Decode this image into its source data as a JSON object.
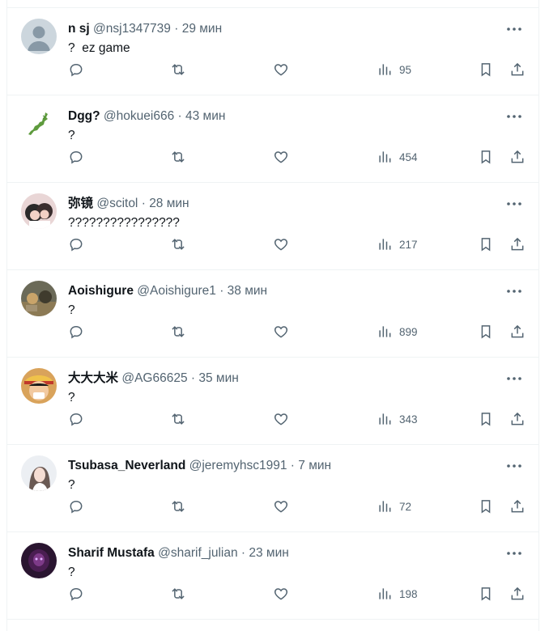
{
  "tweets": [
    {
      "name": "n sj",
      "handle": "@nsj1347739",
      "time": "29 мин",
      "text": "?  ez game",
      "views": "95",
      "avatar_color": "#ccd6dd"
    },
    {
      "name": "Dgg?",
      "handle": "@hokuei666",
      "time": "43 мин",
      "text": "?",
      "views": "454",
      "avatar_color": "#ffffff"
    },
    {
      "name": "弥镜",
      "handle": "@scitol",
      "time": "28 мин",
      "text": "????????????????",
      "views": "217",
      "avatar_color": "#e9d6d6"
    },
    {
      "name": "Aoishigure",
      "handle": "@Aoishigure1",
      "time": "38 мин",
      "text": "?",
      "views": "899",
      "avatar_color": "#6b6a58"
    },
    {
      "name": "大大大米",
      "handle": "@AG66625",
      "time": "35 мин",
      "text": "?",
      "views": "343",
      "avatar_color": "#d9a35b"
    },
    {
      "name": "Tsubasa_Neverland",
      "handle": "@jeremyhsc1991",
      "time": "7 мин",
      "text": "?",
      "views": "72",
      "avatar_color": "#eceff3"
    },
    {
      "name": "Sharif Mustafa",
      "handle": "@sharif_julian",
      "time": "23 мин",
      "text": "?",
      "views": "198",
      "avatar_color": "#2a1530"
    }
  ],
  "separator": "·",
  "icons": [
    "reply-icon",
    "retweet-icon",
    "like-icon",
    "views-icon",
    "bookmark-icon",
    "share-icon",
    "more-icon"
  ]
}
